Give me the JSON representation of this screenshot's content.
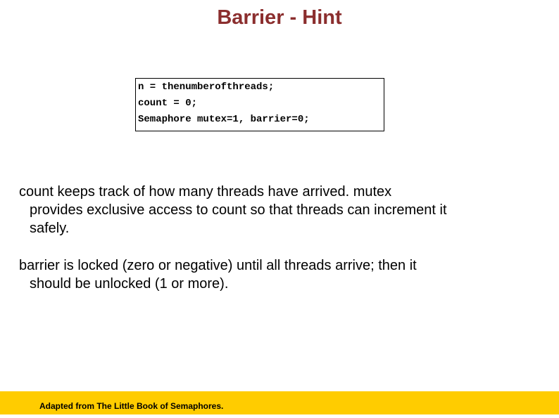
{
  "colors": {
    "title": "#8b2e2e",
    "footer_background": "#ffcc00",
    "text": "#000000"
  },
  "slide": {
    "title": "Barrier - Hint",
    "code": {
      "lines": [
        "n = thenumberofthreads;",
        "count = 0;",
        "Semaphore mutex=1, barrier=0;"
      ]
    },
    "paragraphs": [
      {
        "lines": [
          "count keeps track of how many threads have arrived. mutex",
          "provides exclusive access to count so that threads can increment it",
          "safely."
        ]
      },
      {
        "lines": [
          "barrier is locked (zero or negative) until all threads arrive; then it",
          "should be unlocked (1 or more)."
        ]
      }
    ],
    "footer": {
      "text": "Adapted from The Little Book of Semaphores."
    }
  }
}
